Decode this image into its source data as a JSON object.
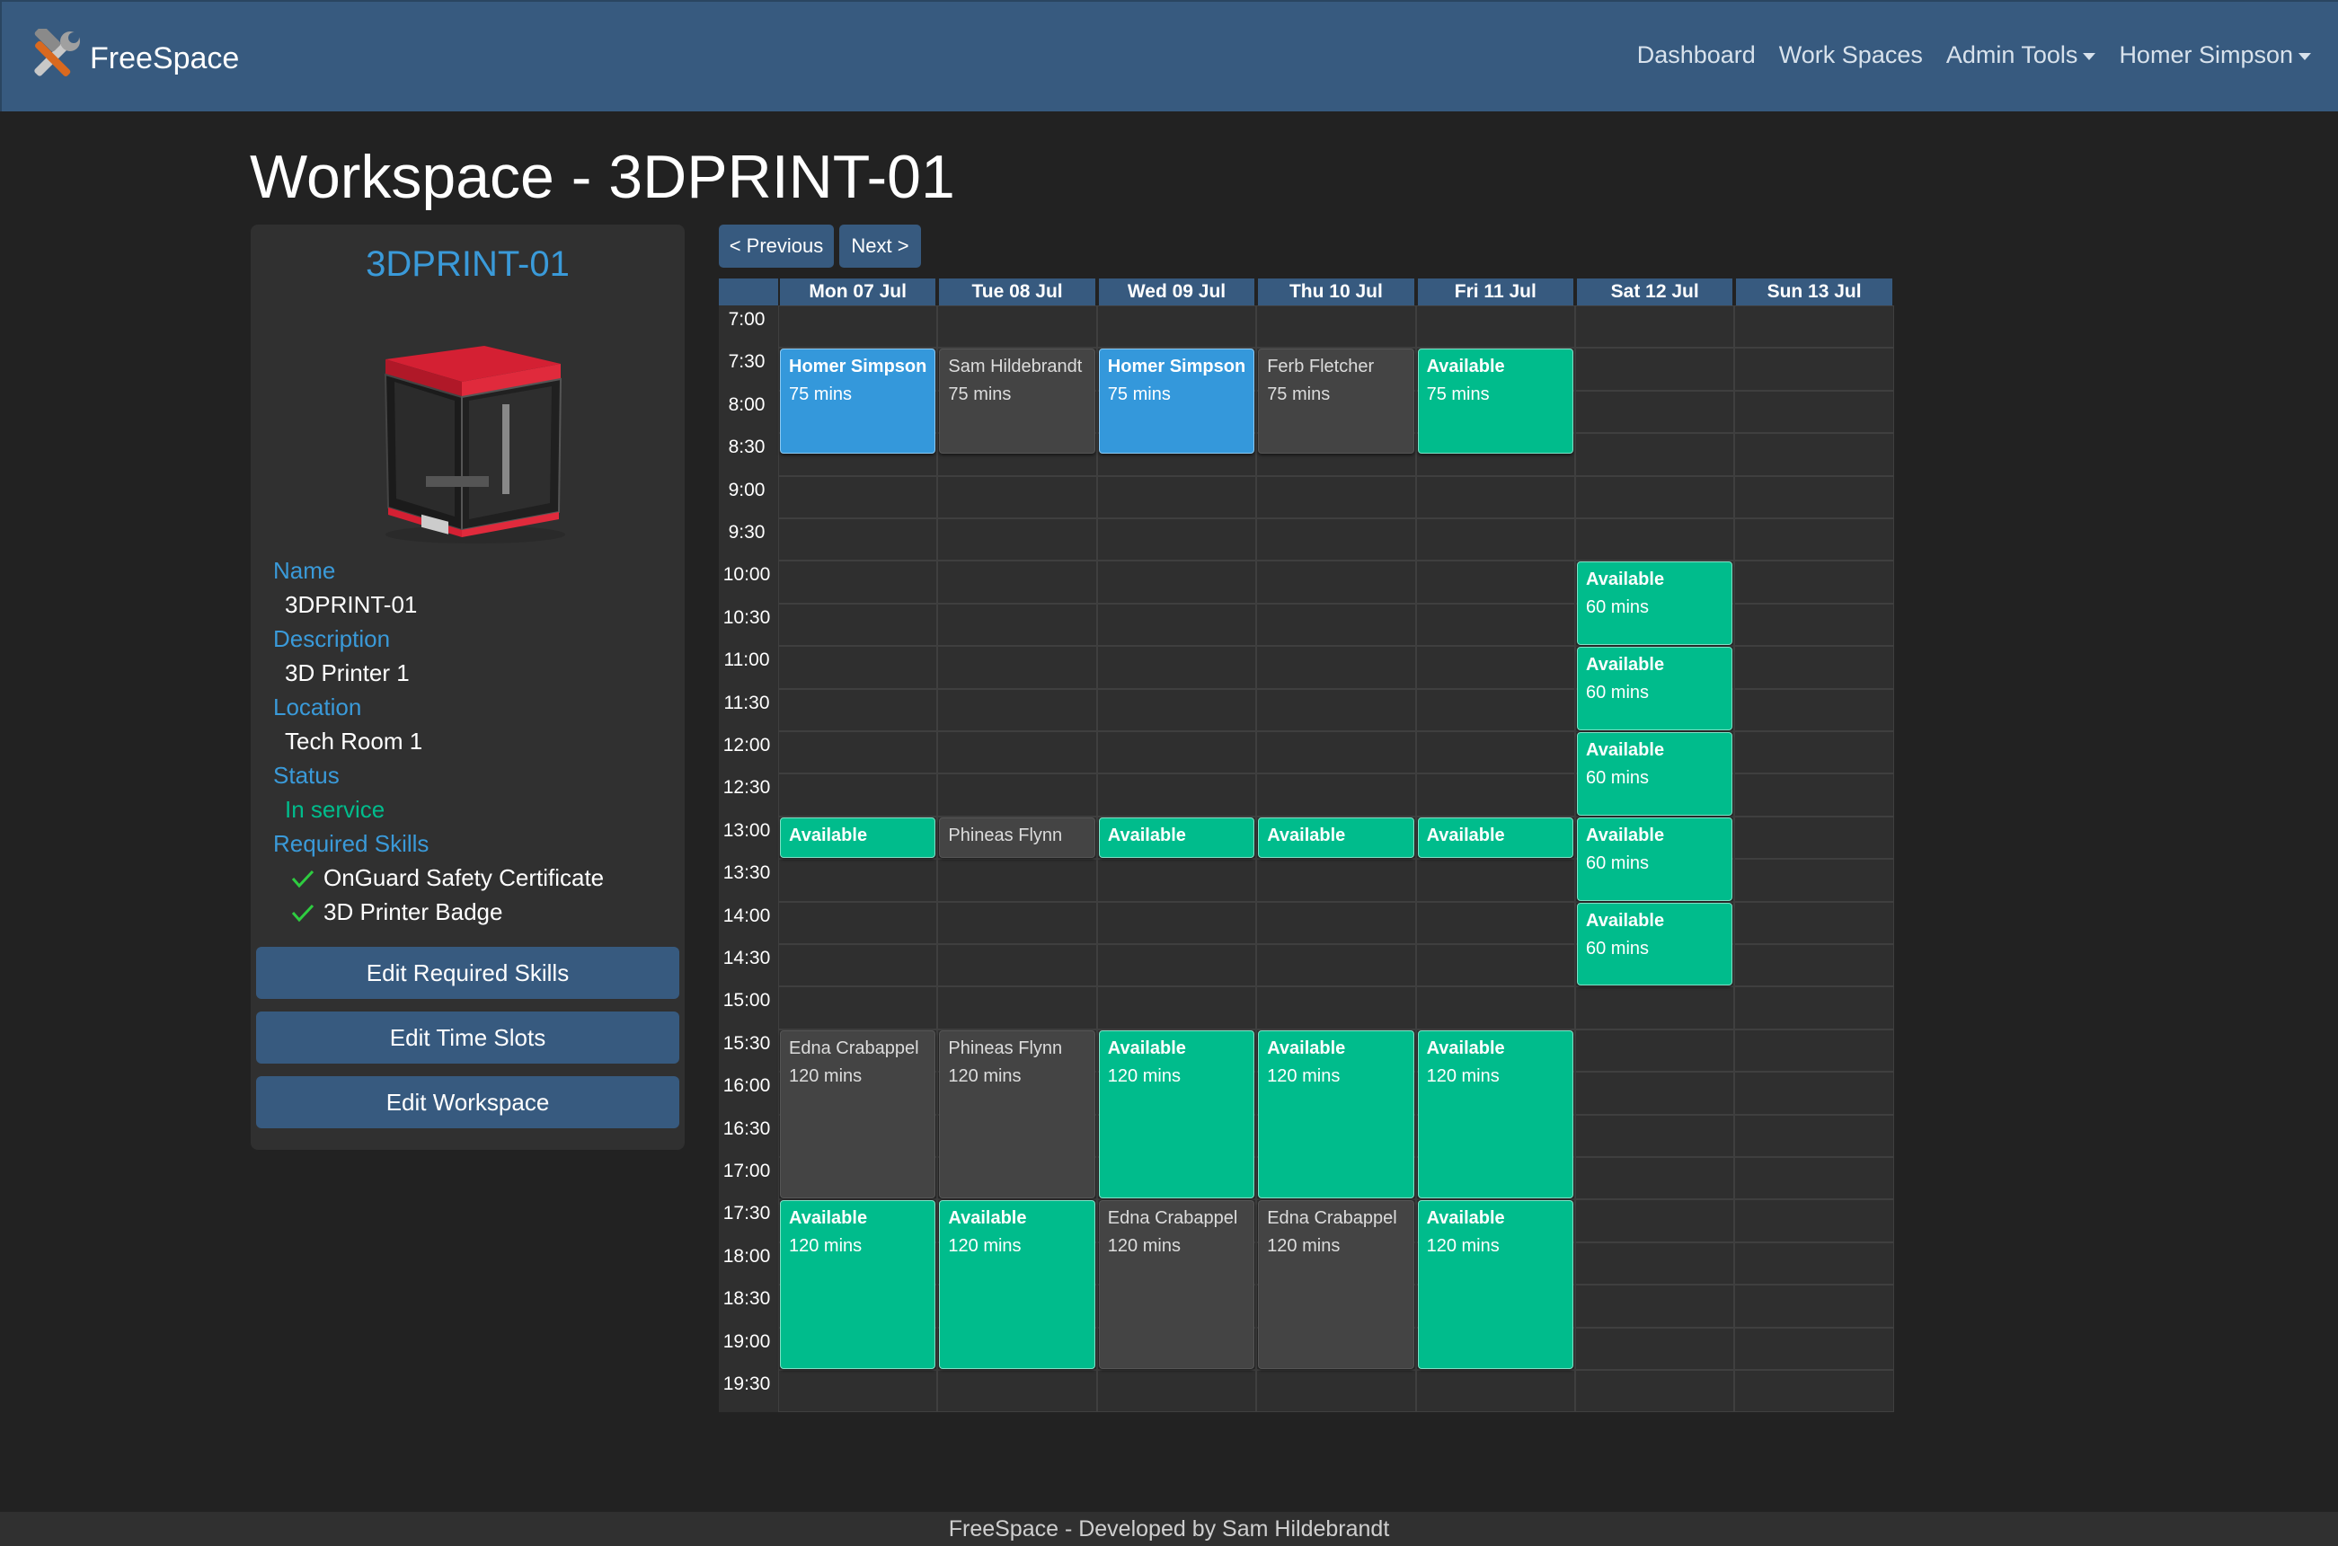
{
  "brand": "FreeSpace",
  "nav": {
    "dashboard": "Dashboard",
    "workspaces": "Work Spaces",
    "admin_tools": "Admin Tools",
    "user": "Homer Simpson"
  },
  "page_title": "Workspace - 3DPRINT-01",
  "card": {
    "title": "3DPRINT-01",
    "name_label": "Name",
    "name_value": "3DPRINT-01",
    "description_label": "Description",
    "description_value": "3D Printer 1",
    "location_label": "Location",
    "location_value": "Tech Room 1",
    "status_label": "Status",
    "status_value": "In service",
    "skills_label": "Required Skills",
    "skills": [
      "OnGuard Safety Certificate",
      "3D Printer Badge"
    ],
    "buttons": [
      "Edit Required Skills",
      "Edit Time Slots",
      "Edit Workspace"
    ]
  },
  "calendar": {
    "previous": "< Previous",
    "next": "Next >",
    "days": [
      "Mon 07 Jul",
      "Tue 08 Jul",
      "Wed 09 Jul",
      "Thu 10 Jul",
      "Fri 11 Jul",
      "Sat 12 Jul",
      "Sun 13 Jul"
    ],
    "times": [
      "7:00",
      "7:30",
      "8:00",
      "8:30",
      "9:00",
      "9:30",
      "10:00",
      "10:30",
      "11:00",
      "11:30",
      "12:00",
      "12:30",
      "13:00",
      "13:30",
      "14:00",
      "14:30",
      "15:00",
      "15:30",
      "16:00",
      "16:30",
      "17:00",
      "17:30",
      "18:00",
      "18:30",
      "19:00",
      "19:30"
    ],
    "events": [
      {
        "day": 0,
        "start": "7:30",
        "title": "Homer Simpson",
        "duration": "75 mins",
        "kind": "mine",
        "minutes": 75
      },
      {
        "day": 1,
        "start": "7:30",
        "title": "Sam Hildebrandt",
        "duration": "75 mins",
        "kind": "booked",
        "minutes": 75
      },
      {
        "day": 2,
        "start": "7:30",
        "title": "Homer Simpson",
        "duration": "75 mins",
        "kind": "mine",
        "minutes": 75
      },
      {
        "day": 3,
        "start": "7:30",
        "title": "Ferb Fletcher",
        "duration": "75 mins",
        "kind": "booked",
        "minutes": 75
      },
      {
        "day": 4,
        "start": "7:30",
        "title": "Available",
        "duration": "75 mins",
        "kind": "available",
        "minutes": 75
      },
      {
        "day": 5,
        "start": "10:00",
        "title": "Available",
        "duration": "60 mins",
        "kind": "available",
        "minutes": 60
      },
      {
        "day": 5,
        "start": "11:00",
        "title": "Available",
        "duration": "60 mins",
        "kind": "available",
        "minutes": 60
      },
      {
        "day": 5,
        "start": "12:00",
        "title": "Available",
        "duration": "60 mins",
        "kind": "available",
        "minutes": 60
      },
      {
        "day": 5,
        "start": "13:00",
        "title": "Available",
        "duration": "60 mins",
        "kind": "available",
        "minutes": 60
      },
      {
        "day": 5,
        "start": "14:00",
        "title": "Available",
        "duration": "60 mins",
        "kind": "available",
        "minutes": 60
      },
      {
        "day": 0,
        "start": "13:00",
        "title": "Available",
        "duration": "",
        "kind": "available",
        "minutes": 30
      },
      {
        "day": 1,
        "start": "13:00",
        "title": "Phineas Flynn",
        "duration": "",
        "kind": "booked",
        "minutes": 30
      },
      {
        "day": 2,
        "start": "13:00",
        "title": "Available",
        "duration": "",
        "kind": "available",
        "minutes": 30
      },
      {
        "day": 3,
        "start": "13:00",
        "title": "Available",
        "duration": "",
        "kind": "available",
        "minutes": 30
      },
      {
        "day": 4,
        "start": "13:00",
        "title": "Available",
        "duration": "",
        "kind": "available",
        "minutes": 30
      },
      {
        "day": 0,
        "start": "15:30",
        "title": "Edna Crabappel",
        "duration": "120 mins",
        "kind": "booked",
        "minutes": 120
      },
      {
        "day": 1,
        "start": "15:30",
        "title": "Phineas Flynn",
        "duration": "120 mins",
        "kind": "booked",
        "minutes": 120
      },
      {
        "day": 2,
        "start": "15:30",
        "title": "Available",
        "duration": "120 mins",
        "kind": "available",
        "minutes": 120
      },
      {
        "day": 3,
        "start": "15:30",
        "title": "Available",
        "duration": "120 mins",
        "kind": "available",
        "minutes": 120
      },
      {
        "day": 4,
        "start": "15:30",
        "title": "Available",
        "duration": "120 mins",
        "kind": "available",
        "minutes": 120
      },
      {
        "day": 0,
        "start": "17:30",
        "title": "Available",
        "duration": "120 mins",
        "kind": "available",
        "minutes": 120
      },
      {
        "day": 1,
        "start": "17:30",
        "title": "Available",
        "duration": "120 mins",
        "kind": "available",
        "minutes": 120
      },
      {
        "day": 2,
        "start": "17:30",
        "title": "Edna Crabappel",
        "duration": "120 mins",
        "kind": "booked",
        "minutes": 120
      },
      {
        "day": 3,
        "start": "17:30",
        "title": "Edna Crabappel",
        "duration": "120 mins",
        "kind": "booked",
        "minutes": 120
      },
      {
        "day": 4,
        "start": "17:30",
        "title": "Available",
        "duration": "120 mins",
        "kind": "available",
        "minutes": 120
      }
    ]
  },
  "footer": "FreeSpace - Developed by Sam Hildebrandt",
  "colors": {
    "navbar": "#375a7f",
    "background": "#222222",
    "available": "#00bc8c",
    "mine": "#3498db",
    "booked": "#444444",
    "label_blue": "#3a9ad9"
  }
}
